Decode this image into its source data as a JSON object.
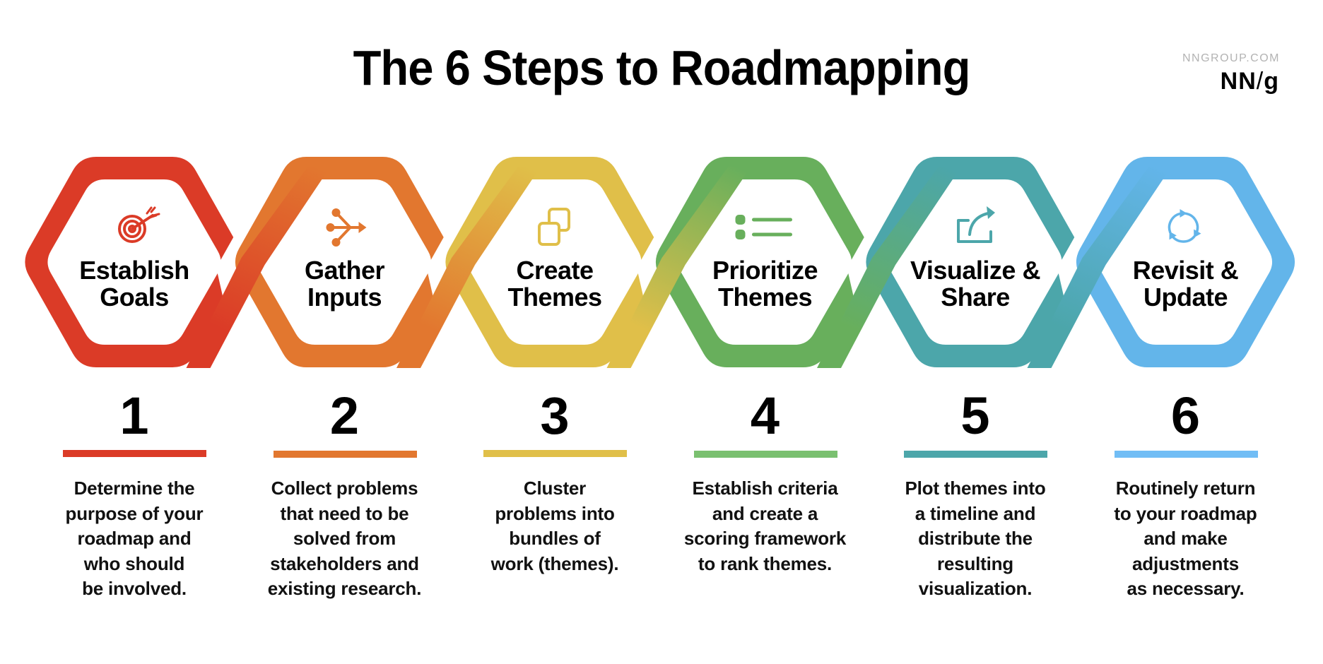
{
  "header": {
    "title": "The 6 Steps to Roadmapping",
    "brand_url": "NNGROUP.COM",
    "brand_logo_left": "NN",
    "brand_logo_slash": "/",
    "brand_logo_right": "g"
  },
  "steps": [
    {
      "number": "1",
      "label_line1": "Establish",
      "label_line2": "Goals",
      "icon": "target-icon",
      "color": "#db3b27",
      "description": [
        "Determine the",
        "purpose of your",
        "roadmap and",
        "who should",
        "be involved."
      ]
    },
    {
      "number": "2",
      "label_line1": "Gather",
      "label_line2": "Inputs",
      "icon": "merge-arrow-icon",
      "color": "#e2772f",
      "description": [
        "Collect problems",
        "that need to be",
        "solved from",
        "stakeholders and",
        "existing research."
      ]
    },
    {
      "number": "3",
      "label_line1": "Create",
      "label_line2": "Themes",
      "icon": "stacked-squares-icon",
      "color": "#e0bf49",
      "description": [
        "Cluster",
        "problems into",
        "bundles of",
        "work (themes)."
      ]
    },
    {
      "number": "4",
      "label_line1": "Prioritize",
      "label_line2": "Themes",
      "icon": "list-icon",
      "color": "#68af5c",
      "description": [
        "Establish criteria",
        "and create a",
        "scoring framework",
        "to rank themes."
      ]
    },
    {
      "number": "5",
      "label_line1": "Visualize &",
      "label_line2": "Share",
      "icon": "share-icon",
      "color": "#4ca6aa",
      "description": [
        "Plot themes into",
        "a timeline and",
        "distribute the",
        "resulting",
        "visualization."
      ]
    },
    {
      "number": "6",
      "label_line1": "Revisit &",
      "label_line2": "Update",
      "icon": "cycle-icon",
      "color": "#63b5ea",
      "description": [
        "Routinely return",
        "to your roadmap",
        "and make",
        "adjustments",
        "as necessary."
      ]
    }
  ],
  "bar_colors": [
    "#db3b27",
    "#e2772f",
    "#e0bf49",
    "#7ac070",
    "#4ca6aa",
    "#71bdf5"
  ]
}
